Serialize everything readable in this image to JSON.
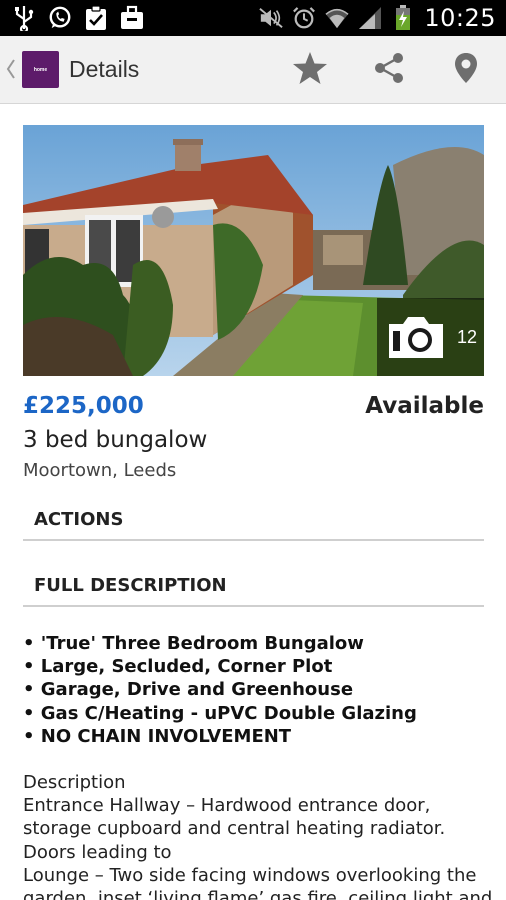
{
  "status_bar": {
    "time": "10:25",
    "left_icons": [
      "usb-icon",
      "whatsapp-icon",
      "clipboard-check-icon",
      "briefcase-icon"
    ],
    "right_icons": [
      "mute-icon",
      "alarm-icon",
      "wifi-icon",
      "signal-icon",
      "battery-charging-icon"
    ]
  },
  "action_bar": {
    "title": "Details",
    "logo_text": "home",
    "actions": [
      "star-icon",
      "share-icon",
      "location-pin-icon"
    ]
  },
  "listing": {
    "photo_count": "12",
    "price": "£225,000",
    "status": "Available",
    "type": "3 bed bungalow",
    "location": "Moortown, Leeds"
  },
  "sections": {
    "actions": "ACTIONS",
    "full_description": "FULL DESCRIPTION"
  },
  "features": [
    "• 'True' Three Bedroom Bungalow",
    "• Large, Secluded, Corner Plot",
    "• Garage, Drive and Greenhouse",
    "• Gas C/Heating - uPVC Double Glazing",
    "• NO CHAIN INVOLVEMENT"
  ],
  "description_lines": [
    "Description",
    "Entrance Hallway – Hardwood entrance door,",
    "storage cupboard and central heating radiator.",
    "Doors leading to",
    "Lounge – Two side facing windows overlooking the",
    "garden, inset ‘living flame’ gas fire, ceiling light and"
  ],
  "colors": {
    "price": "#1c66c6",
    "brand": "#5d1b6a",
    "action_bar_bg": "#f1f1f1",
    "icon_gray": "#6e6e6e"
  }
}
